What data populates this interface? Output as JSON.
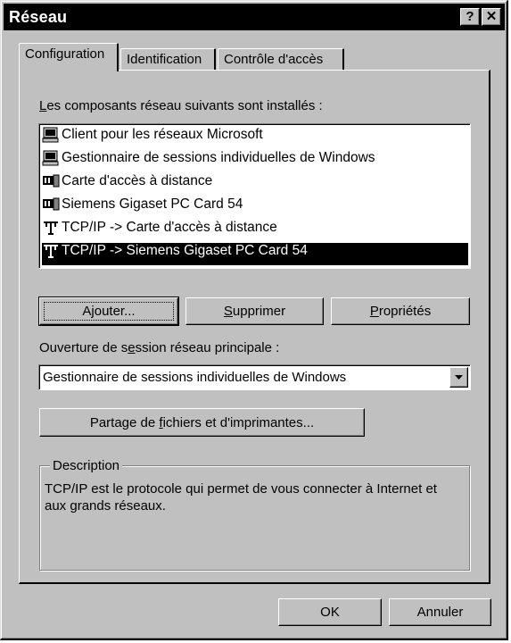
{
  "window": {
    "title": "Réseau",
    "help_glyph": "?",
    "close_glyph": "✕"
  },
  "tabs": [
    {
      "label": "Configuration",
      "active": true
    },
    {
      "label": "Identification",
      "active": false
    },
    {
      "label": "Contrôle d'accès",
      "active": false
    }
  ],
  "config": {
    "installed_label_mn": "L",
    "installed_label_rest": "es composants réseau suivants sont installés :",
    "components": [
      {
        "label": "Client pour les réseaux Microsoft",
        "icon": "computer-icon",
        "selected": false
      },
      {
        "label": "Gestionnaire de sessions individuelles de Windows",
        "icon": "computer-icon",
        "selected": false
      },
      {
        "label": "Carte d'accès à distance",
        "icon": "network-card-icon",
        "selected": false
      },
      {
        "label": "Siemens Gigaset PC Card 54",
        "icon": "network-card-icon",
        "selected": false
      },
      {
        "label": "TCP/IP -> Carte d'accès à distance",
        "icon": "protocol-icon",
        "selected": false
      },
      {
        "label": "TCP/IP -> Siemens Gigaset PC Card 54",
        "icon": "protocol-icon",
        "selected": true
      }
    ],
    "buttons": {
      "add_pre": "A",
      "add_mn": "j",
      "add_post": "outer...",
      "remove_pre": "",
      "remove_mn": "S",
      "remove_post": "upprimer",
      "props_pre": "",
      "props_mn": "P",
      "props_post": "ropriétés"
    },
    "logon_label_pre": "Ouverture de s",
    "logon_label_mn": "e",
    "logon_label_post": "ssion réseau principale :",
    "logon_value": "Gestionnaire de sessions individuelles de Windows",
    "share_pre": "Partage de ",
    "share_mn": "f",
    "share_post": "ichiers et d'imprimantes...",
    "description_title": "Description",
    "description_text": "TCP/IP est le protocole qui permet de vous connecter à Internet et aux grands réseaux."
  },
  "footer": {
    "ok": "OK",
    "cancel": "Annuler"
  }
}
